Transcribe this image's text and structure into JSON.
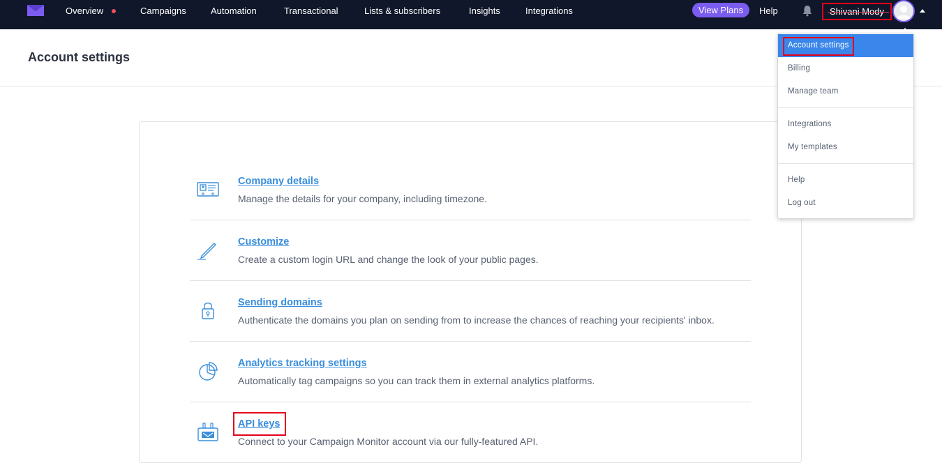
{
  "nav": {
    "items": [
      "Overview",
      "Campaigns",
      "Automation",
      "Transactional",
      "Lists & subscribers",
      "Insights",
      "Integrations"
    ],
    "view_plans": "View Plans",
    "help": "Help",
    "user_name": "Shivani Mody"
  },
  "colors": {
    "nav_bg": "#10172a",
    "accent": "#7b5cf0",
    "link": "#3a8edb",
    "active_menu": "#3b86ea",
    "highlight": "#e3001b"
  },
  "header": {
    "title": "Account settings"
  },
  "settings": [
    {
      "icon": "id-card-icon",
      "title": "Company details",
      "desc": "Manage the details for your company, including timezone."
    },
    {
      "icon": "pen-icon",
      "title": "Customize",
      "desc": "Create a custom login URL and change the look of your public pages."
    },
    {
      "icon": "lock-icon",
      "title": "Sending domains",
      "desc": "Authenticate the domains you plan on sending from to increase the chances of reaching your recipients' inbox."
    },
    {
      "icon": "pie-chart-icon",
      "title": "Analytics tracking settings",
      "desc": "Automatically tag campaigns so you can track them in external analytics platforms."
    },
    {
      "icon": "api-plug-icon",
      "title": "API keys",
      "desc": "Connect to your Campaign Monitor account via our fully-featured API."
    }
  ],
  "dropdown": {
    "items": [
      "Account settings",
      "Billing",
      "Manage team",
      "Integrations",
      "My templates",
      "Help",
      "Log out"
    ],
    "active": "Account settings"
  }
}
